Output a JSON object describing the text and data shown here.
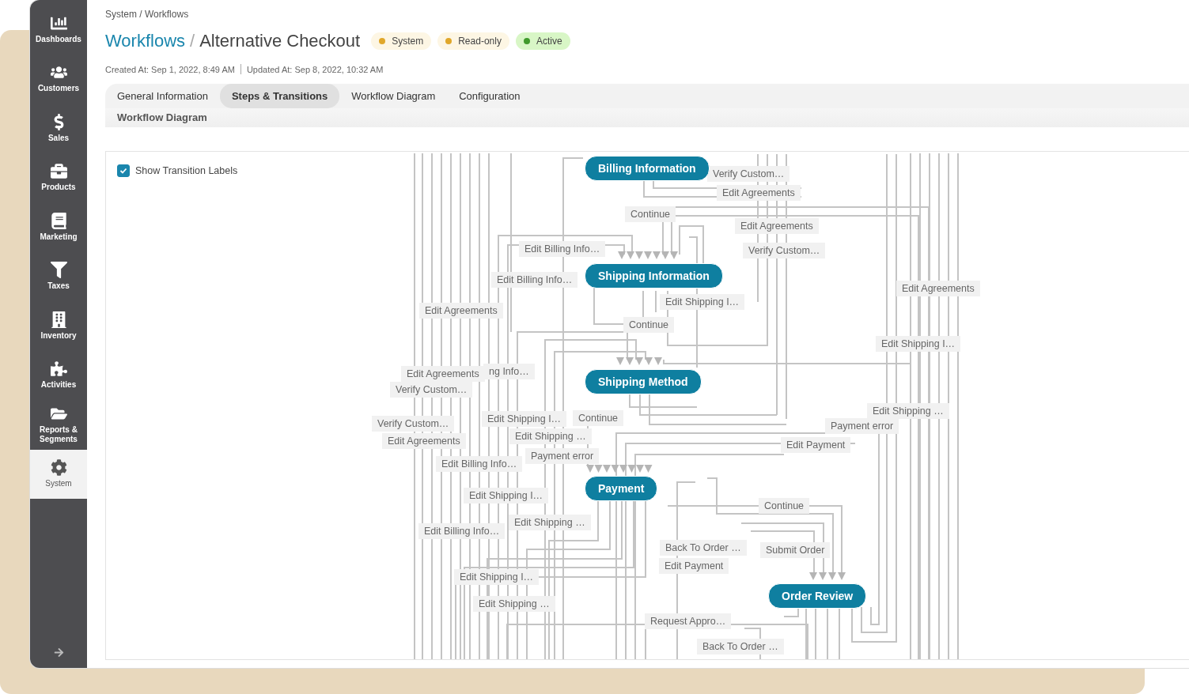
{
  "sidebar": {
    "items": [
      {
        "label": "Dashboards",
        "kind": "chart",
        "selected": false
      },
      {
        "label": "Customers",
        "kind": "users",
        "selected": false
      },
      {
        "label": "Sales",
        "kind": "dollar",
        "selected": false
      },
      {
        "label": "Products",
        "kind": "briefcase",
        "selected": false
      },
      {
        "label": "Marketing",
        "kind": "book",
        "selected": false
      },
      {
        "label": "Taxes",
        "kind": "filter",
        "selected": false
      },
      {
        "label": "Inventory",
        "kind": "building",
        "selected": false
      },
      {
        "label": "Activities",
        "kind": "puzzle",
        "selected": false
      },
      {
        "label": "Reports & Segments",
        "kind": "folder",
        "selected": false
      },
      {
        "label": "System",
        "kind": "gear",
        "selected": true
      }
    ]
  },
  "breadcrumb": "System / Workflows",
  "title": {
    "parent": "Workflows",
    "separator": "/",
    "name": "Alternative Checkout"
  },
  "badges": [
    {
      "label": "System",
      "color": "#e0a72a"
    },
    {
      "label": "Read-only",
      "color": "#e0a72a"
    },
    {
      "label": "Active",
      "color": "#3f9a2b"
    }
  ],
  "meta": {
    "created": "Created At: Sep 1, 2022, 8:49 AM",
    "updated": "Updated At: Sep 8, 2022, 10:32 AM"
  },
  "tabs": [
    {
      "label": "General Information",
      "selected": false
    },
    {
      "label": "Steps & Transitions",
      "selected": true
    },
    {
      "label": "Workflow Diagram",
      "selected": false
    },
    {
      "label": "Configuration",
      "selected": false
    }
  ],
  "section_title": "Workflow Diagram",
  "show_labels": {
    "label": "Show Transition Labels",
    "checked": true
  },
  "diagram": {
    "steps": [
      "Billing Information",
      "Shipping Information",
      "Shipping Method",
      "Payment",
      "Order Review"
    ],
    "transitions": [
      "Verify Custom…",
      "Edit Agreements",
      "Continue",
      "Edit Agreements",
      "Edit Billing Info…",
      "Verify Custom…",
      "Edit Billing Info…",
      "Edit Shipping I…",
      "Edit Agreements",
      "Edit Agreements",
      "Continue",
      "Edit Shipping I…",
      "Edit Agreements",
      "ng Info…",
      "Verify Custom…",
      "Verify Custom…",
      "Edit Shipping I…",
      "Continue",
      "Edit Agreements",
      "Edit Shipping …",
      "Edit Shipping …",
      "Payment error",
      "Edit Payment",
      "Payment error",
      "Edit Billing Info…",
      "Edit Shipping I…",
      "Continue",
      "Edit Shipping …",
      "Edit Billing Info…",
      "Back To Order …",
      "Submit Order",
      "Edit Payment",
      "Edit Shipping I…",
      "Edit Shipping …",
      "Request Appro…",
      "Back To Order …"
    ]
  }
}
